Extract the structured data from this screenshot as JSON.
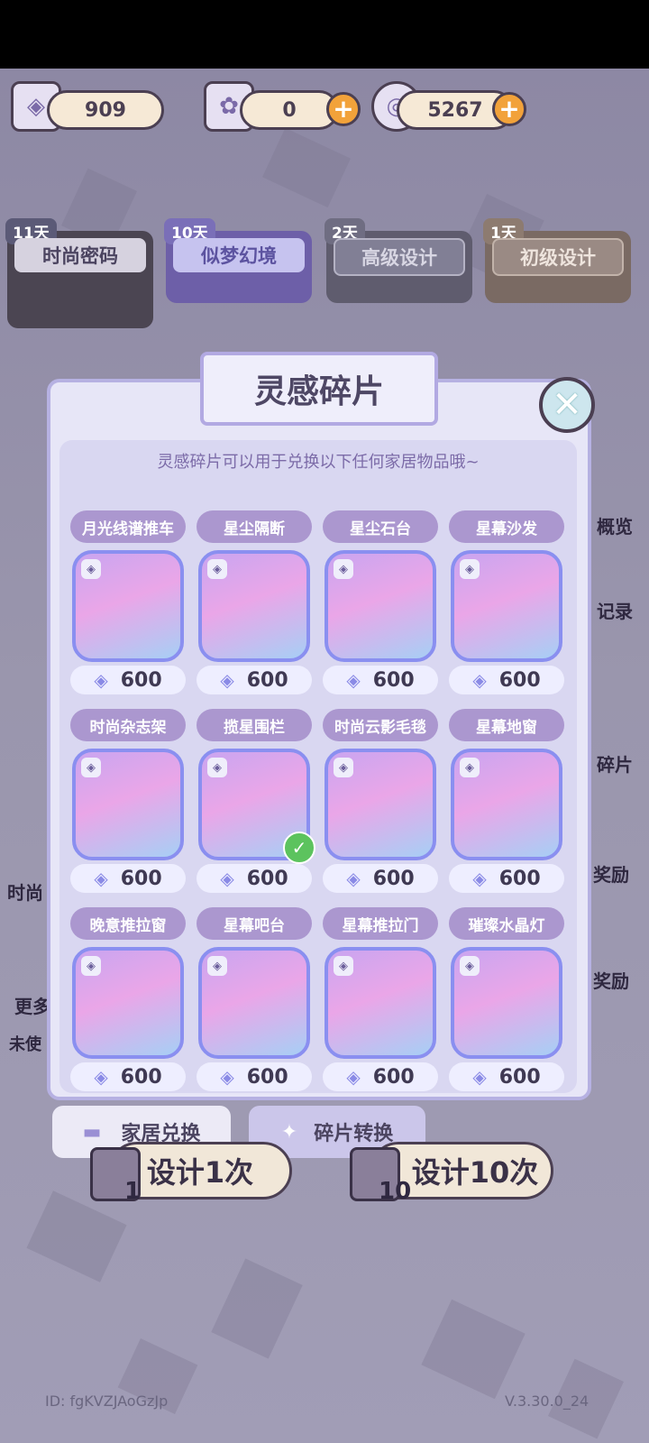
{
  "currencies": {
    "fragments": "909",
    "tickets": "0",
    "spiral": "5267"
  },
  "pools": [
    {
      "days": "11天",
      "label": "时尚密码"
    },
    {
      "days": "10天",
      "label": "似梦幻境"
    },
    {
      "days": "2天",
      "label": "高级设计"
    },
    {
      "days": "1天",
      "label": "初级设计"
    }
  ],
  "modal": {
    "title": "灵感碎片",
    "hint": "灵感碎片可以用于兑换以下任何家居物品哦~",
    "items": [
      {
        "name": "月光线谱推车",
        "price": "600"
      },
      {
        "name": "星尘隔断",
        "price": "600"
      },
      {
        "name": "星尘石台",
        "price": "600"
      },
      {
        "name": "星幕沙发",
        "price": "600"
      },
      {
        "name": "时尚杂志架",
        "price": "600"
      },
      {
        "name": "揽星围栏",
        "price": "600"
      },
      {
        "name": "时尚云影毛毯",
        "price": "600"
      },
      {
        "name": "星幕地窗",
        "price": "600"
      },
      {
        "name": "晚意推拉窗",
        "price": "600"
      },
      {
        "name": "星幕吧台",
        "price": "600"
      },
      {
        "name": "星幕推拉门",
        "price": "600"
      },
      {
        "name": "璀璨水晶灯",
        "price": "600"
      }
    ]
  },
  "bottom_tabs": {
    "home_exchange": "家居兑换",
    "fragment_convert": "碎片转换"
  },
  "draw": {
    "once": "设计1次",
    "once_count": "1",
    "ten": "设计10次",
    "ten_count": "10"
  },
  "side": {
    "overview": "概览",
    "record": "记录",
    "fragment": "碎片",
    "reward1": "奖励",
    "reward2": "奖励",
    "left1": "时尚",
    "left2": "更多",
    "left3": "未使"
  },
  "footer": {
    "id": "ID:  fgKVZJAoGzJp",
    "version": "V.3.30.0_24"
  }
}
